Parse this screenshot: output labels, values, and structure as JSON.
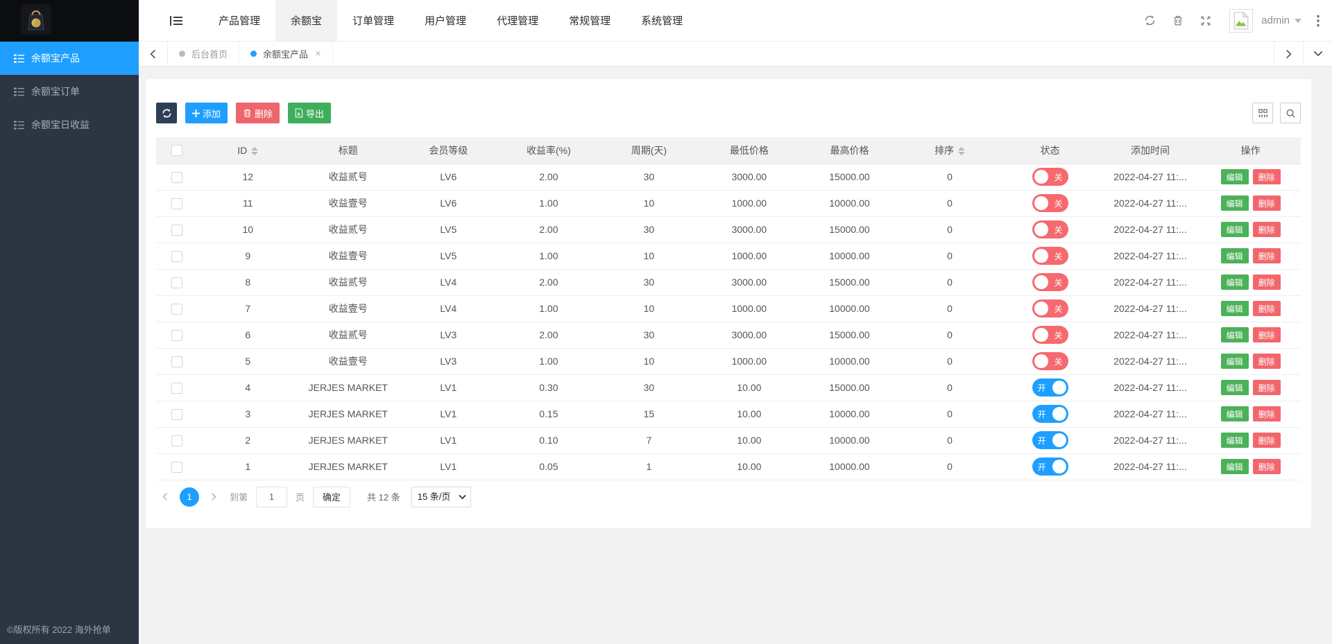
{
  "sidebar": {
    "menu": [
      {
        "label": "余额宝产品",
        "active": true
      },
      {
        "label": "余额宝订单",
        "active": false
      },
      {
        "label": "余额宝日收益",
        "active": false
      }
    ],
    "copyright": "©版权所有 2022 海外抢单"
  },
  "navbar": {
    "tabs": [
      {
        "label": "产品管理",
        "active": false
      },
      {
        "label": "余额宝",
        "active": true
      },
      {
        "label": "订单管理",
        "active": false
      },
      {
        "label": "用户管理",
        "active": false
      },
      {
        "label": "代理管理",
        "active": false
      },
      {
        "label": "常规管理",
        "active": false
      },
      {
        "label": "系统管理",
        "active": false
      }
    ],
    "username": "admin"
  },
  "tabbar": {
    "tabs": [
      {
        "label": "后台首页",
        "active": false,
        "closable": false
      },
      {
        "label": "余额宝产品",
        "active": true,
        "closable": true
      }
    ]
  },
  "toolbar": {
    "add": "添加",
    "delete": "删除",
    "export": "导出"
  },
  "table": {
    "columns": [
      {
        "label": "ID",
        "sortable": true
      },
      {
        "label": "标题",
        "sortable": false
      },
      {
        "label": "会员等级",
        "sortable": false
      },
      {
        "label": "收益率(%)",
        "sortable": false
      },
      {
        "label": "周期(天)",
        "sortable": false
      },
      {
        "label": "最低价格",
        "sortable": false
      },
      {
        "label": "最高价格",
        "sortable": false
      },
      {
        "label": "排序",
        "sortable": true
      },
      {
        "label": "状态",
        "sortable": false
      },
      {
        "label": "添加时间",
        "sortable": false
      },
      {
        "label": "操作",
        "sortable": false
      }
    ],
    "switch_on": "开",
    "switch_off": "关",
    "edit_label": "编辑",
    "delete_label": "删除",
    "rows": [
      {
        "id": "12",
        "title": "收益贰号",
        "level": "LV6",
        "rate": "2.00",
        "period": "30",
        "min_price": "3000.00",
        "max_price": "15000.00",
        "sort": "0",
        "status": "off",
        "time": "2022-04-27 11:..."
      },
      {
        "id": "11",
        "title": "收益壹号",
        "level": "LV6",
        "rate": "1.00",
        "period": "10",
        "min_price": "1000.00",
        "max_price": "10000.00",
        "sort": "0",
        "status": "off",
        "time": "2022-04-27 11:..."
      },
      {
        "id": "10",
        "title": "收益贰号",
        "level": "LV5",
        "rate": "2.00",
        "period": "30",
        "min_price": "3000.00",
        "max_price": "15000.00",
        "sort": "0",
        "status": "off",
        "time": "2022-04-27 11:..."
      },
      {
        "id": "9",
        "title": "收益壹号",
        "level": "LV5",
        "rate": "1.00",
        "period": "10",
        "min_price": "1000.00",
        "max_price": "10000.00",
        "sort": "0",
        "status": "off",
        "time": "2022-04-27 11:..."
      },
      {
        "id": "8",
        "title": "收益贰号",
        "level": "LV4",
        "rate": "2.00",
        "period": "30",
        "min_price": "3000.00",
        "max_price": "15000.00",
        "sort": "0",
        "status": "off",
        "time": "2022-04-27 11:..."
      },
      {
        "id": "7",
        "title": "收益壹号",
        "level": "LV4",
        "rate": "1.00",
        "period": "10",
        "min_price": "1000.00",
        "max_price": "10000.00",
        "sort": "0",
        "status": "off",
        "time": "2022-04-27 11:..."
      },
      {
        "id": "6",
        "title": "收益贰号",
        "level": "LV3",
        "rate": "2.00",
        "period": "30",
        "min_price": "3000.00",
        "max_price": "15000.00",
        "sort": "0",
        "status": "off",
        "time": "2022-04-27 11:..."
      },
      {
        "id": "5",
        "title": "收益壹号",
        "level": "LV3",
        "rate": "1.00",
        "period": "10",
        "min_price": "1000.00",
        "max_price": "10000.00",
        "sort": "0",
        "status": "off",
        "time": "2022-04-27 11:..."
      },
      {
        "id": "4",
        "title": "JERJES MARKET",
        "level": "LV1",
        "rate": "0.30",
        "period": "30",
        "min_price": "10.00",
        "max_price": "15000.00",
        "sort": "0",
        "status": "on",
        "time": "2022-04-27 11:..."
      },
      {
        "id": "3",
        "title": "JERJES MARKET",
        "level": "LV1",
        "rate": "0.15",
        "period": "15",
        "min_price": "10.00",
        "max_price": "10000.00",
        "sort": "0",
        "status": "on",
        "time": "2022-04-27 11:..."
      },
      {
        "id": "2",
        "title": "JERJES MARKET",
        "level": "LV1",
        "rate": "0.10",
        "period": "7",
        "min_price": "10.00",
        "max_price": "10000.00",
        "sort": "0",
        "status": "on",
        "time": "2022-04-27 11:..."
      },
      {
        "id": "1",
        "title": "JERJES MARKET",
        "level": "LV1",
        "rate": "0.05",
        "period": "1",
        "min_price": "10.00",
        "max_price": "10000.00",
        "sort": "0",
        "status": "on",
        "time": "2022-04-27 11:..."
      }
    ]
  },
  "pagination": {
    "current": "1",
    "goto_label": "到第",
    "page_input": "1",
    "page_unit": "页",
    "confirm": "确定",
    "total": "共 12 条",
    "per_page": "15 条/页"
  }
}
